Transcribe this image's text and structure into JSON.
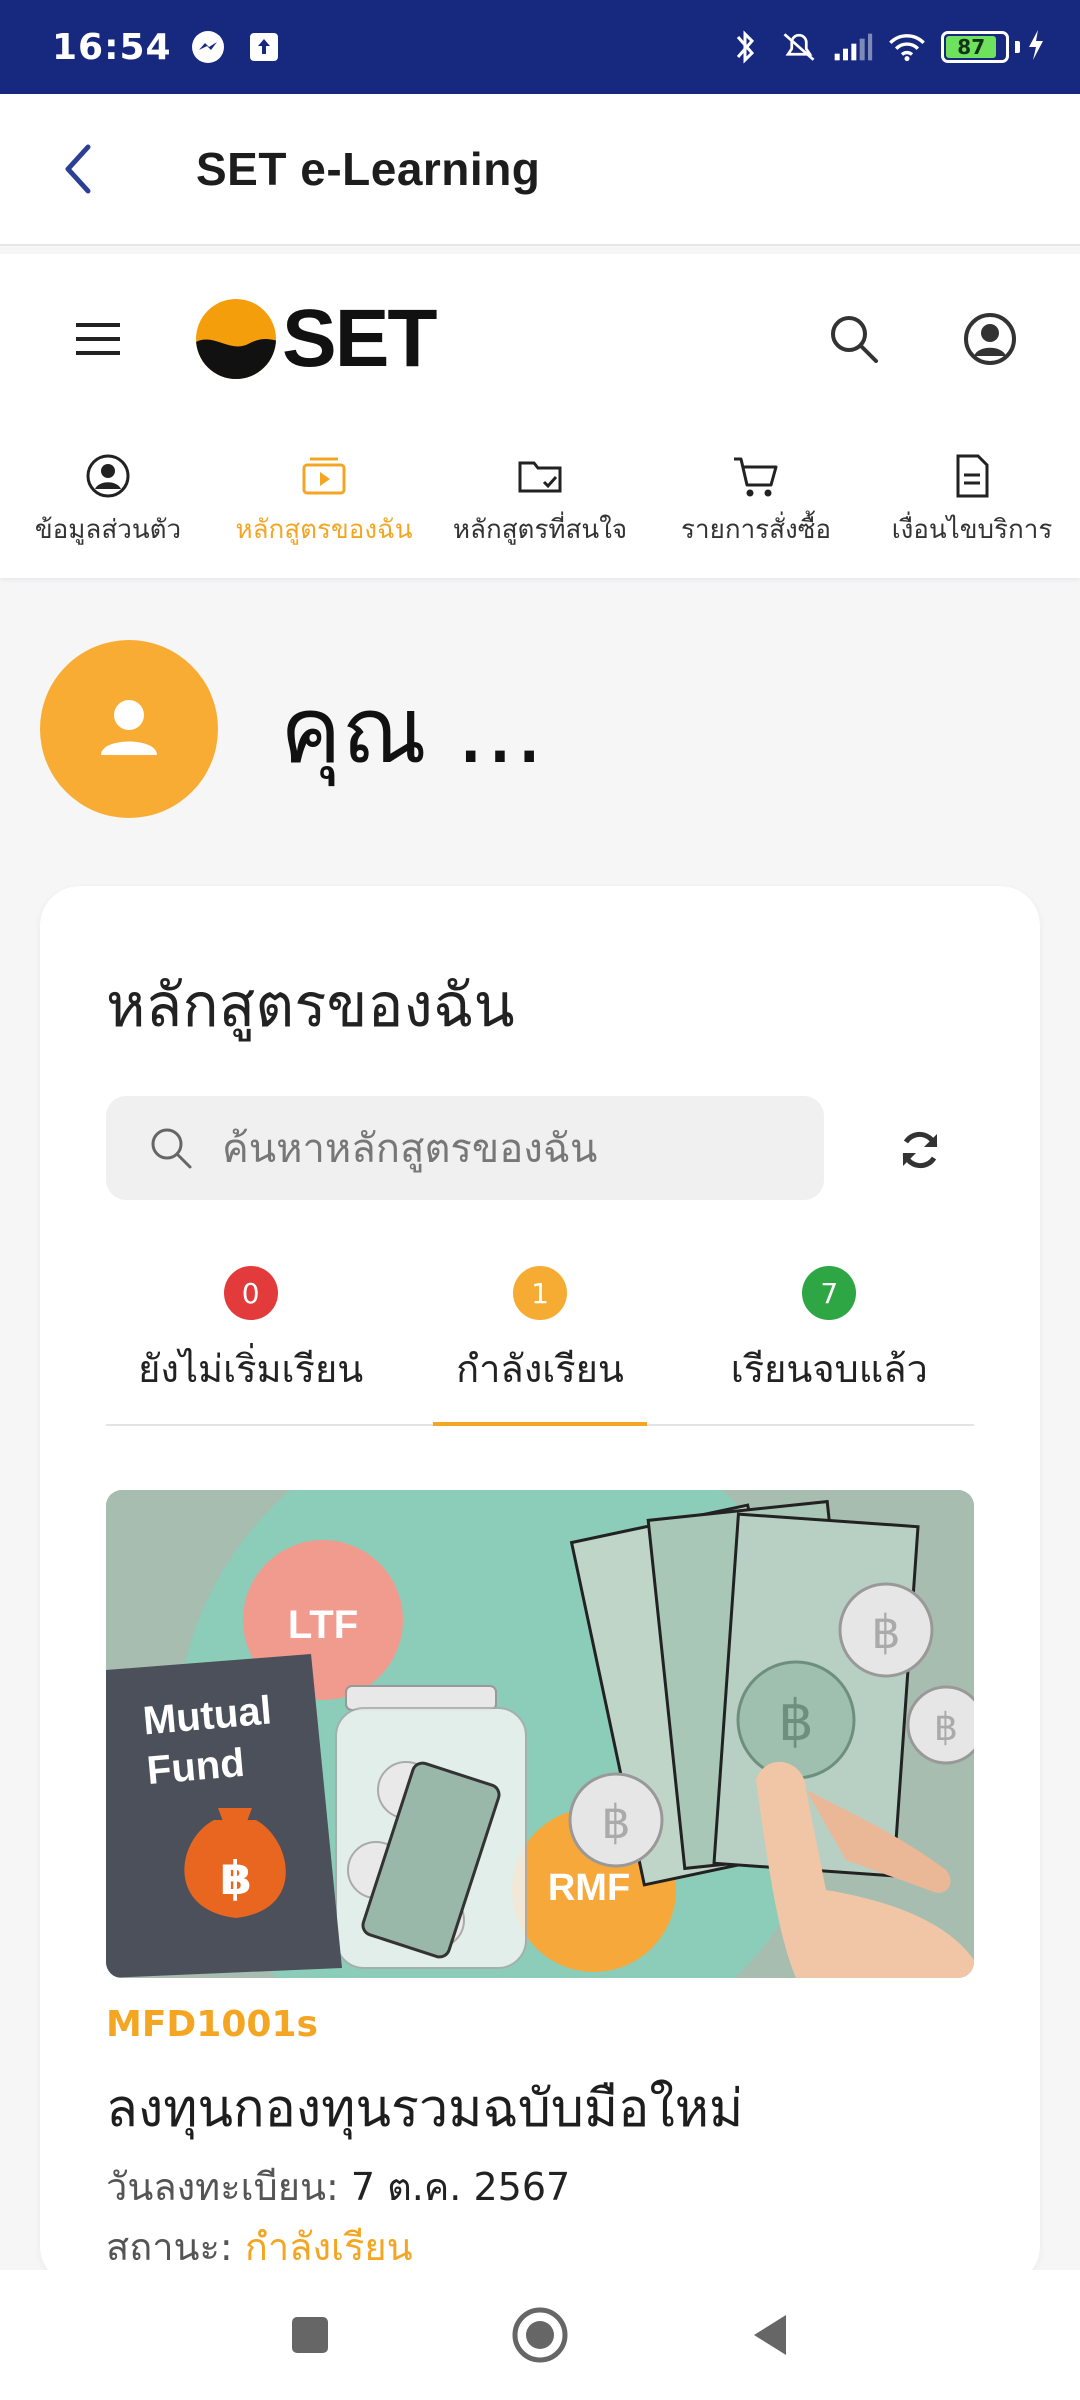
{
  "status_bar": {
    "time": "16:54",
    "battery": "87"
  },
  "app_bar": {
    "title": "SET e-Learning"
  },
  "header": {
    "logo_text": "SET"
  },
  "nav_tabs": [
    {
      "label": "ข้อมูลส่วนตัว",
      "icon": "user-circle-icon",
      "active": false
    },
    {
      "label": "หลักสูตรของฉัน",
      "icon": "video-play-icon",
      "active": true
    },
    {
      "label": "หลักสูตรที่สนใจ",
      "icon": "folder-check-icon",
      "active": false
    },
    {
      "label": "รายการสั่งซื้อ",
      "icon": "cart-icon",
      "active": false
    },
    {
      "label": "เงื่อนไขบริการ",
      "icon": "document-icon",
      "active": false
    }
  ],
  "profile": {
    "name": "คุณ ..."
  },
  "my_courses": {
    "title": "หลักสูตรของฉัน",
    "search_placeholder": "ค้นหาหลักสูตรของฉัน",
    "status_tabs": [
      {
        "count": "0",
        "label": "ยังไม่เริ่มเรียน",
        "color": "#e33b3b",
        "active": false
      },
      {
        "count": "1",
        "label": "กำลังเรียน",
        "color": "#f6ac33",
        "active": true
      },
      {
        "count": "7",
        "label": "เรียนจบแล้ว",
        "color": "#2ea643",
        "active": false
      }
    ],
    "course": {
      "image_texts": {
        "ltf": "LTF",
        "mutual": "Mutual",
        "fund": "Fund",
        "rmf": "RMF",
        "baht": "฿"
      },
      "code": "MFD1001s",
      "title": "ลงทุนกองทุนรวมฉบับมือใหม่",
      "date_label": "วันลงทะเบียน:",
      "date_value": "7 ต.ค. 2567",
      "status_label": "สถานะ:",
      "status_value": "กำลังเรียน"
    }
  },
  "colors": {
    "accent": "#f4a623",
    "statusbar": "#17297e",
    "avatar": "#f8ac34"
  }
}
